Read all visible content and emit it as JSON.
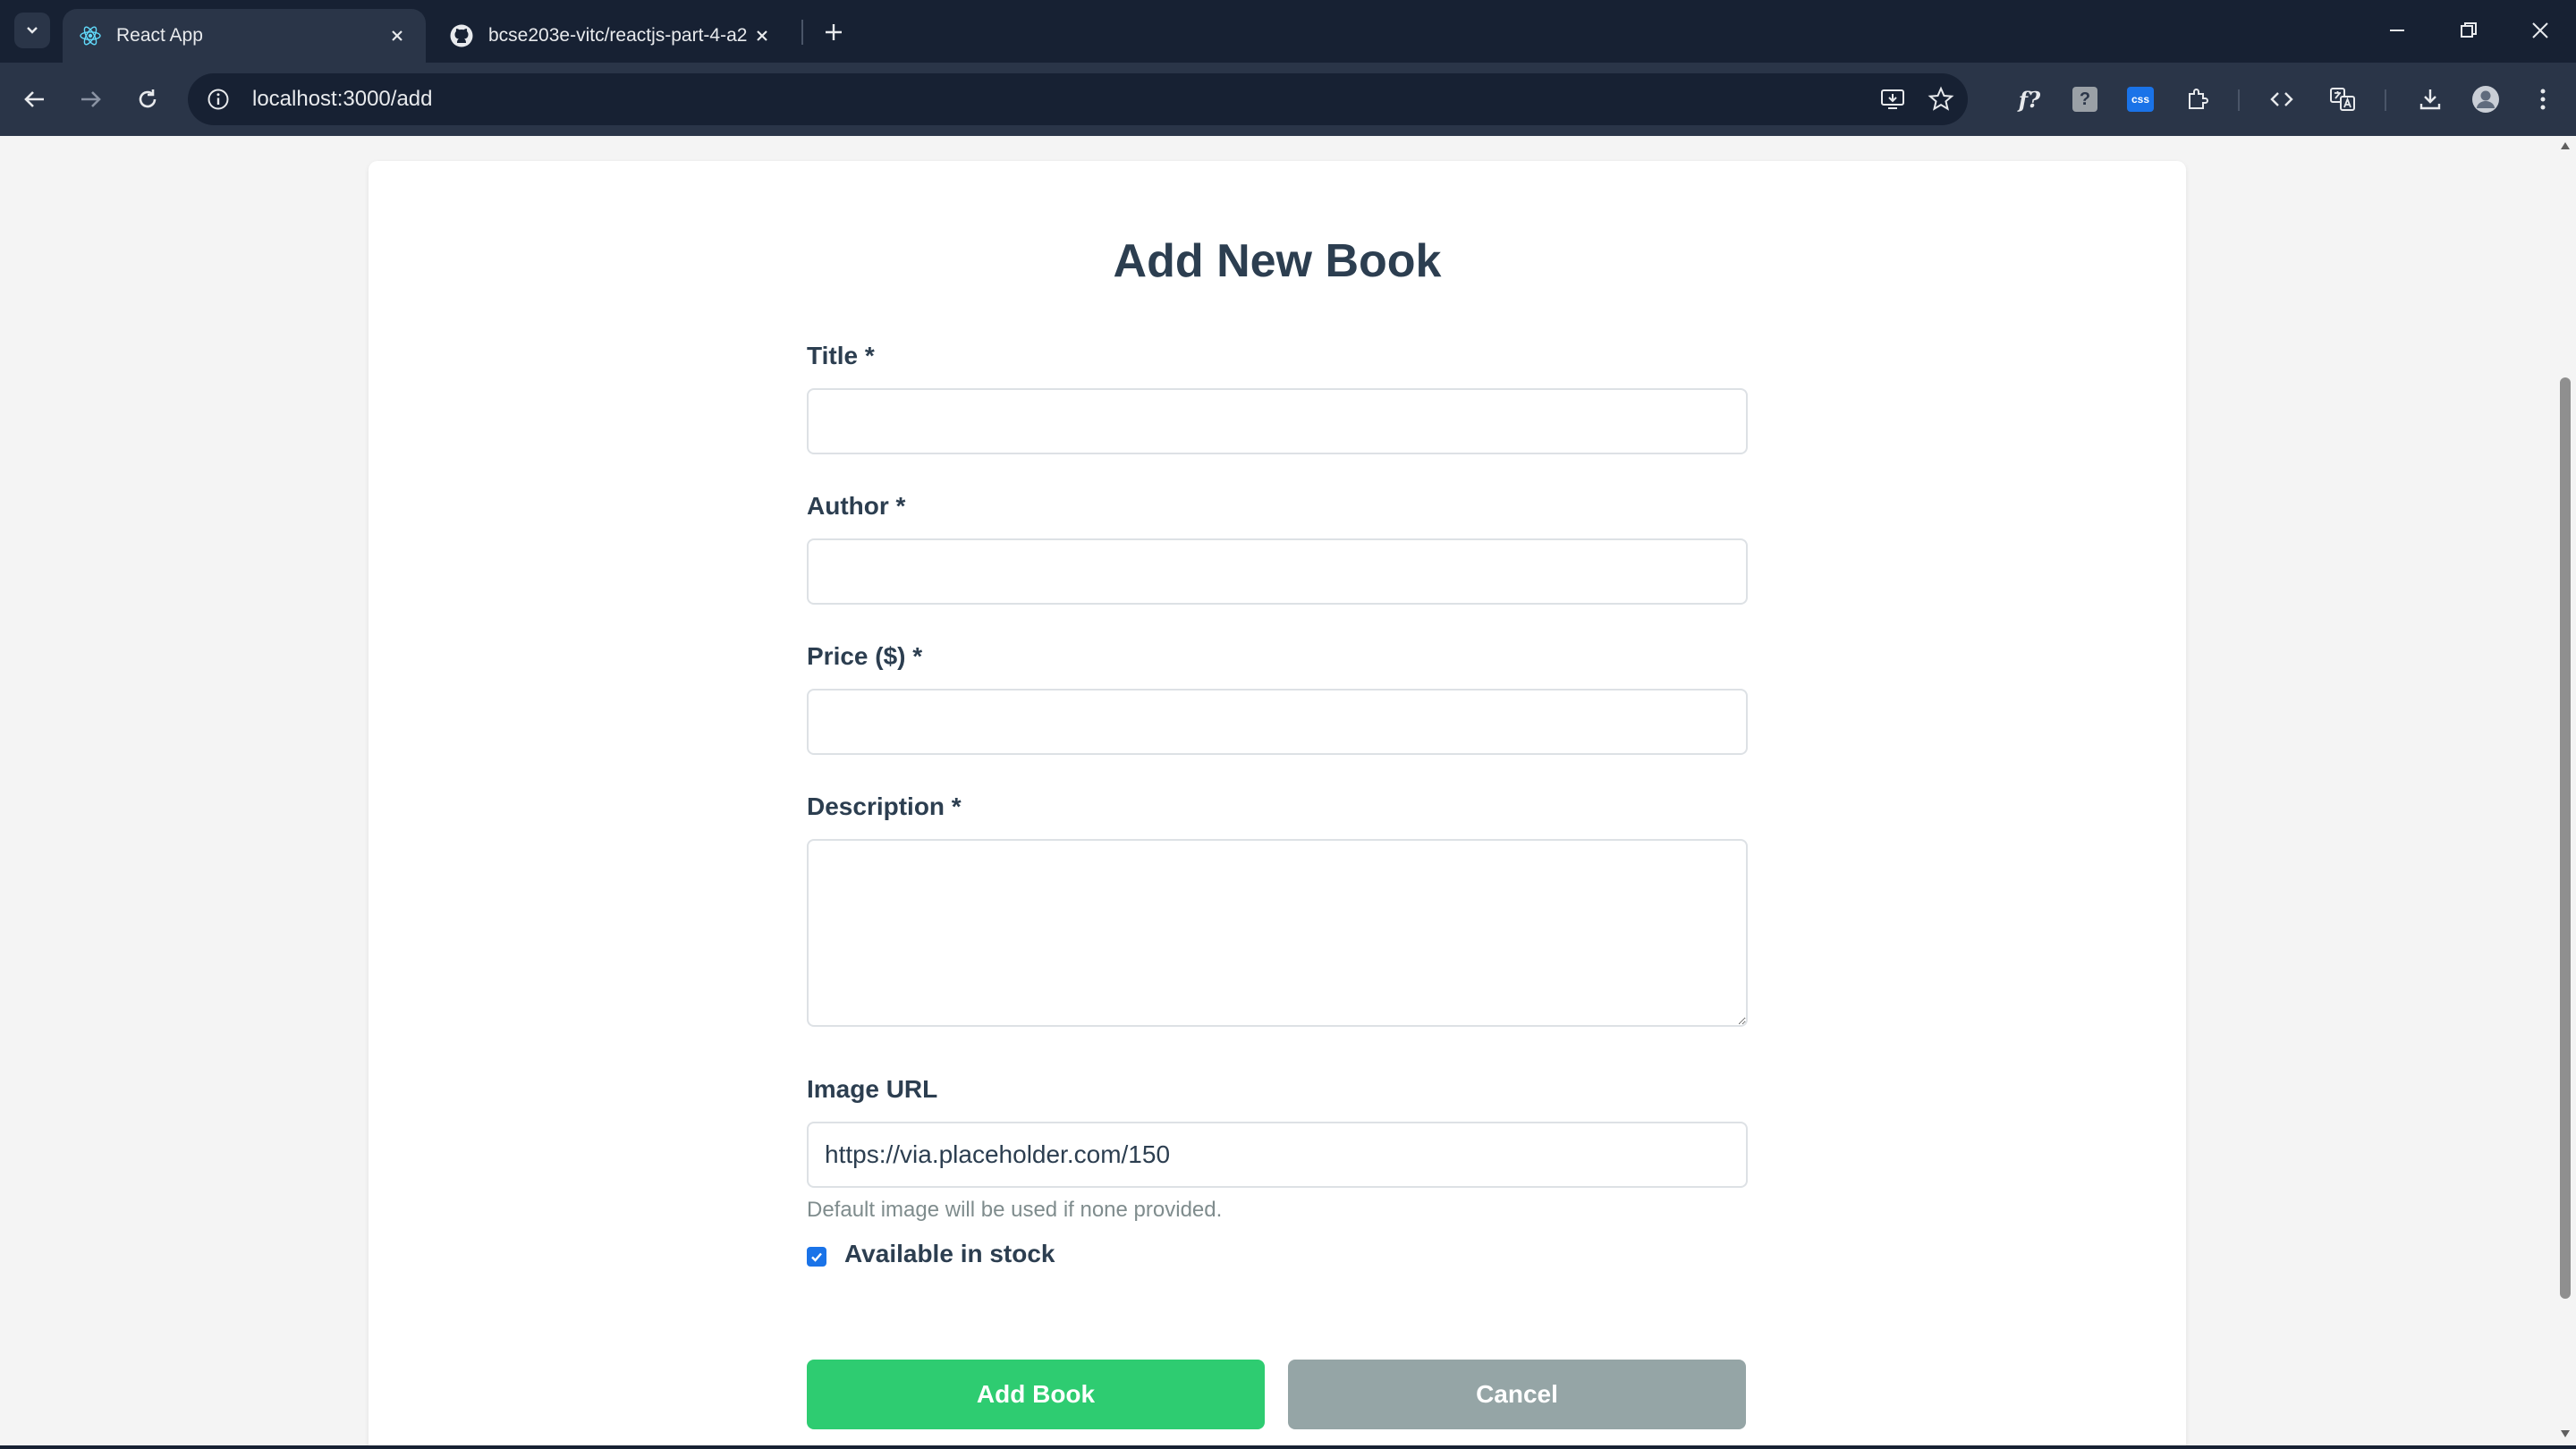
{
  "browser": {
    "tabs": [
      {
        "title": "React App",
        "active": true
      },
      {
        "title": "bcse203e-vitc/reactjs-part-4-a2",
        "active": false
      }
    ],
    "url": "localhost:3000/add",
    "extension_f_label": "f?",
    "extension_q_label": "?",
    "extension_css_label": "css"
  },
  "form": {
    "heading": "Add New Book",
    "title_label": "Title *",
    "title_value": "",
    "author_label": "Author *",
    "author_value": "",
    "price_label": "Price ($) *",
    "price_value": "",
    "description_label": "Description *",
    "description_value": "",
    "image_label": "Image URL",
    "image_value": "https://via.placeholder.com/150",
    "image_help": "Default image will be used if none provided.",
    "stock_label": "Available in stock",
    "stock_checked": true,
    "submit_label": "Add Book",
    "cancel_label": "Cancel"
  },
  "colors": {
    "accent_green": "#2ecc71",
    "cancel_gray": "#95a5a6",
    "heading_text": "#2c3e50",
    "checkbox_blue": "#1a73e8",
    "chrome_dark": "#172133"
  }
}
